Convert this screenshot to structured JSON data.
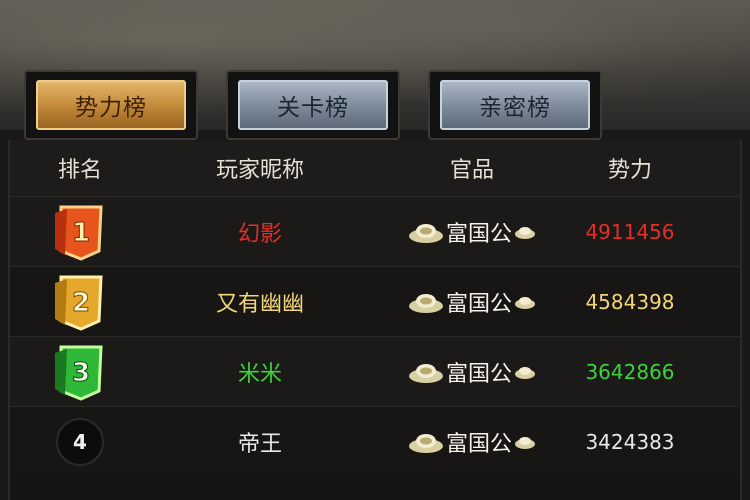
{
  "tabs": [
    {
      "label": "势力榜",
      "active": true
    },
    {
      "label": "关卡榜",
      "active": false
    },
    {
      "label": "亲密榜",
      "active": false
    }
  ],
  "columns": {
    "rank": "排名",
    "player": "玩家昵称",
    "title": "官品",
    "power": "势力"
  },
  "rows": [
    {
      "rank": "1",
      "player": "幻影",
      "title": "富国公",
      "power": "4911456",
      "color": "#e0302a"
    },
    {
      "rank": "2",
      "player": "又有幽幽",
      "title": "富国公",
      "power": "4584398",
      "color": "#f3d67a"
    },
    {
      "rank": "3",
      "player": "米米",
      "title": "富国公",
      "power": "3642866",
      "color": "#3ed23a"
    },
    {
      "rank": "4",
      "player": "帝王",
      "title": "富国公",
      "power": "3424383",
      "color": "#e8e8e8"
    }
  ],
  "colors": {
    "gold_medal": "#e06a1c",
    "silver_medal": "#e8b23a",
    "bronze_medal": "#2fb838"
  }
}
